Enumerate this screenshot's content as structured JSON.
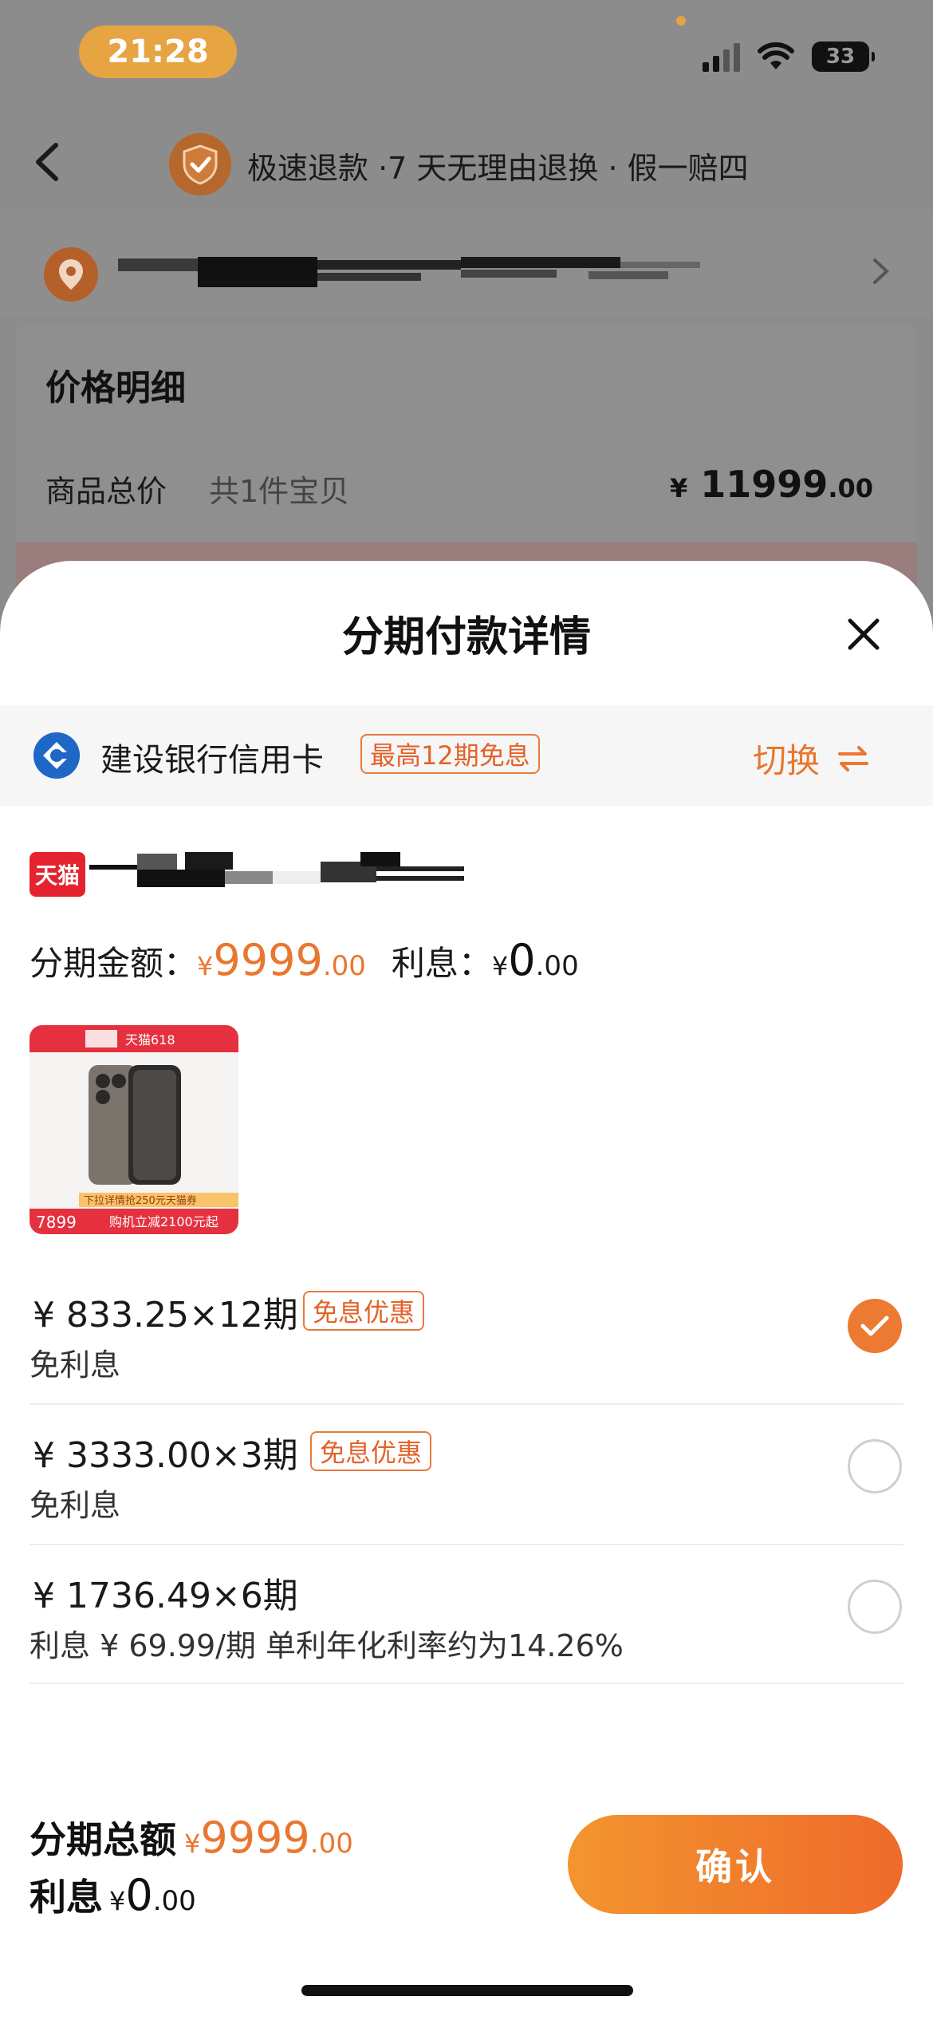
{
  "status_bar": {
    "time": "21:28",
    "battery": "33"
  },
  "header": {
    "guarantee": "极速退款 ·7 天无理由退换 · 假一赔四"
  },
  "price_detail": {
    "title": "价格明细",
    "goods_total_label": "商品总价",
    "goods_count": "共1件宝贝",
    "goods_total_currency": "¥",
    "goods_total_int": "11999",
    "goods_total_dec": ".00"
  },
  "sheet": {
    "title": "分期付款详情",
    "bank": {
      "name": "建设银行信用卡",
      "badge": "最高12期免息",
      "switch_label": "切换"
    },
    "store_logo": "天猫",
    "amount_label": "分期金额：",
    "amount_currency": "¥",
    "amount_int": "9999",
    "amount_dec": ".00",
    "interest_label": "利息：",
    "interest_currency": "¥",
    "interest_int": "0",
    "interest_dec": ".00",
    "product_image": {
      "badge": "天猫618",
      "price": "7899",
      "promo": "下拉详情抢250元天猫券",
      "cut": "购机立减2100元起"
    },
    "plans": [
      {
        "main": "¥ 833.25×12期",
        "tag": "免息优惠",
        "sub": "免利息",
        "selected": true
      },
      {
        "main": "¥ 3333.00×3期",
        "tag": "免息优惠",
        "sub": "免利息",
        "selected": false
      },
      {
        "main": "¥ 1736.49×6期",
        "tag": "",
        "sub": "利息 ¥ 69.99/期 单利年化利率约为14.26%",
        "selected": false
      }
    ],
    "footer": {
      "total_label": "分期总额",
      "total_currency": "¥",
      "total_int": "9999",
      "total_dec": ".00",
      "interest_label": "利息",
      "interest_currency": "¥",
      "interest_int": "0",
      "interest_dec": ".00",
      "confirm_label": "确认"
    }
  },
  "colors": {
    "accent": "#e9772f",
    "tag_border": "#e97a3a",
    "bank_blue": "#1f67c6",
    "tmall_red": "#e4232f"
  }
}
